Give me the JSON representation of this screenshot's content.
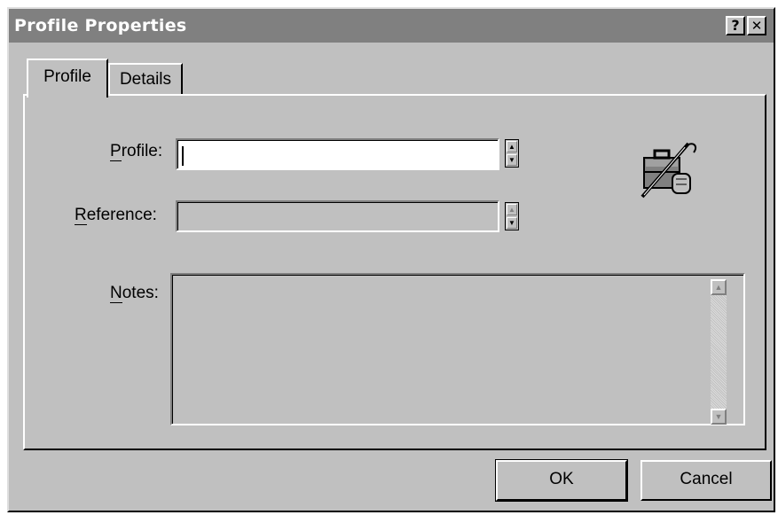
{
  "window": {
    "title": "Profile Properties",
    "help_button": "?",
    "close_button": "✕"
  },
  "tabs": [
    {
      "label": "Profile",
      "active": true
    },
    {
      "label": "Details",
      "active": false
    }
  ],
  "form": {
    "profile": {
      "label_prefix": "",
      "label_mnemonic": "P",
      "label_rest": "rofile:",
      "value": ""
    },
    "reference": {
      "label_mnemonic": "R",
      "label_rest": "eference:",
      "value": ""
    },
    "notes": {
      "label_mnemonic": "N",
      "label_rest": "otes:",
      "value": ""
    }
  },
  "icons": {
    "profile": "briefcase-with-pen-icon"
  },
  "buttons": {
    "ok": "OK",
    "cancel": "Cancel"
  }
}
